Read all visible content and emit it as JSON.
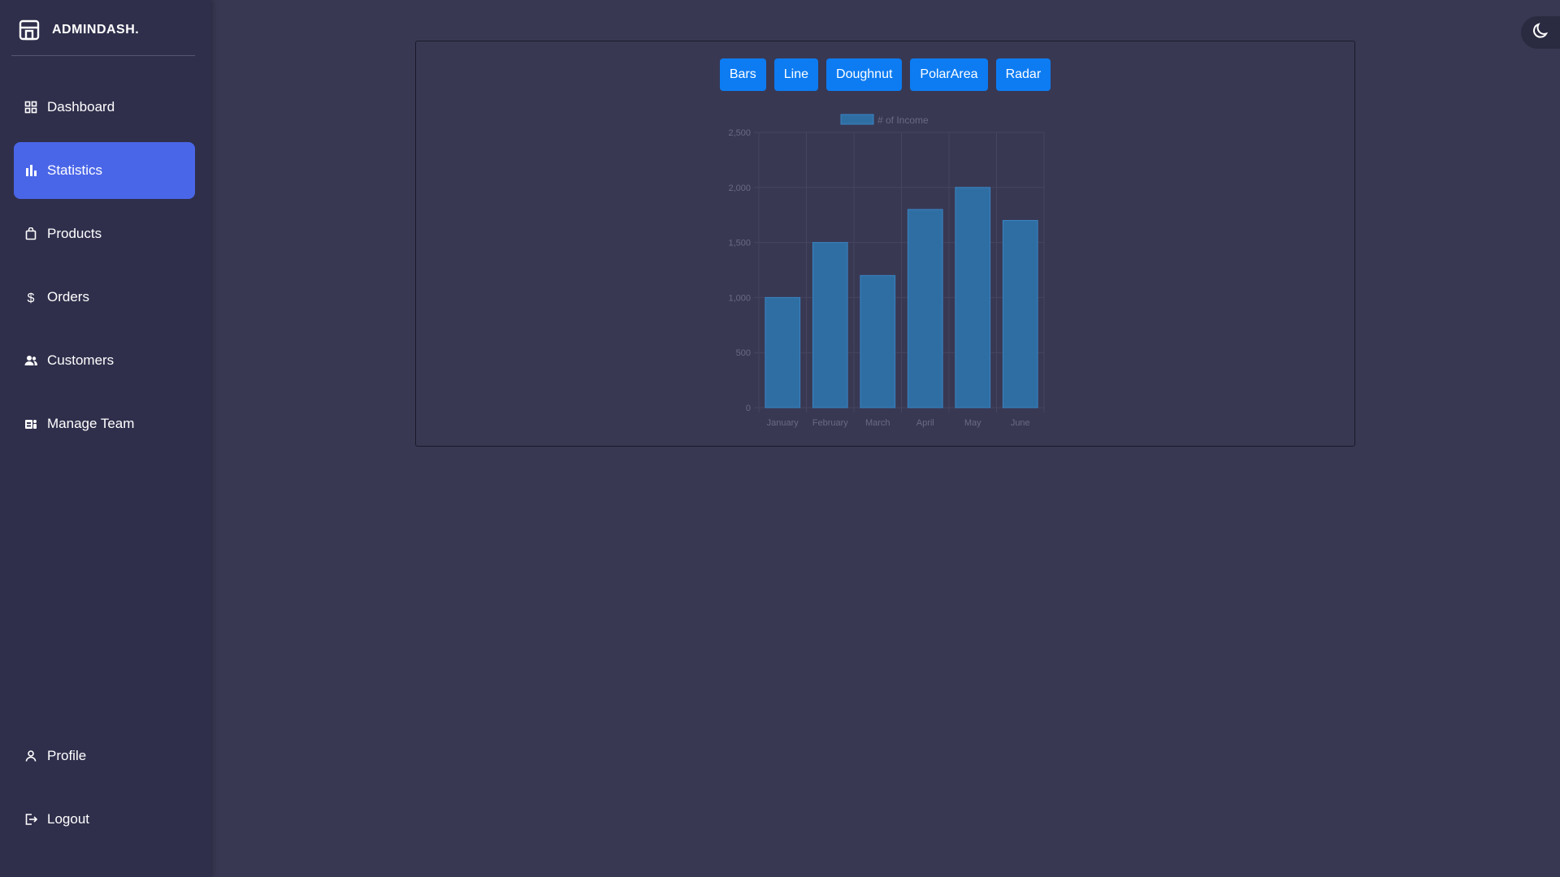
{
  "brand": {
    "title": "ADMINDASH.",
    "icon": "store-icon"
  },
  "nav": [
    {
      "label": "Dashboard",
      "icon": "grid-icon",
      "active": false
    },
    {
      "label": "Statistics",
      "icon": "bar-chart-icon",
      "active": true
    },
    {
      "label": "Products",
      "icon": "shopping-bag-icon",
      "active": false
    },
    {
      "label": "Orders",
      "icon": "dollar-icon",
      "active": false
    },
    {
      "label": "Customers",
      "icon": "users-icon",
      "active": false
    },
    {
      "label": "Manage Team",
      "icon": "team-icon",
      "active": false
    }
  ],
  "nav_bottom": [
    {
      "label": "Profile",
      "icon": "person-icon"
    },
    {
      "label": "Logout",
      "icon": "logout-icon"
    }
  ],
  "theme_toggle": {
    "icon": "moon-icon"
  },
  "chart_buttons": [
    "Bars",
    "Line",
    "Doughnut",
    "PolarArea",
    "Radar"
  ],
  "colors": {
    "background": "#383853",
    "sidebar": "#2f2f4c",
    "active_nav": "#4a66e8",
    "button": "#0d7cf2",
    "bar_fill": "#2f6ea3",
    "bar_border": "#3a84c4"
  },
  "chart_data": {
    "type": "bar",
    "categories": [
      "January",
      "February",
      "March",
      "April",
      "May",
      "June"
    ],
    "series": [
      {
        "name": "# of Income",
        "values": [
          1000,
          1500,
          1200,
          1800,
          2000,
          1700
        ]
      }
    ],
    "ylim": [
      0,
      2500
    ],
    "yticks": [
      0,
      500,
      1000,
      1500,
      2000,
      2500
    ],
    "ytick_labels": [
      "0",
      "500",
      "1,000",
      "1,500",
      "2,000",
      "2,500"
    ],
    "grid": true,
    "legend": "top-center",
    "title": "",
    "xlabel": "",
    "ylabel": ""
  }
}
